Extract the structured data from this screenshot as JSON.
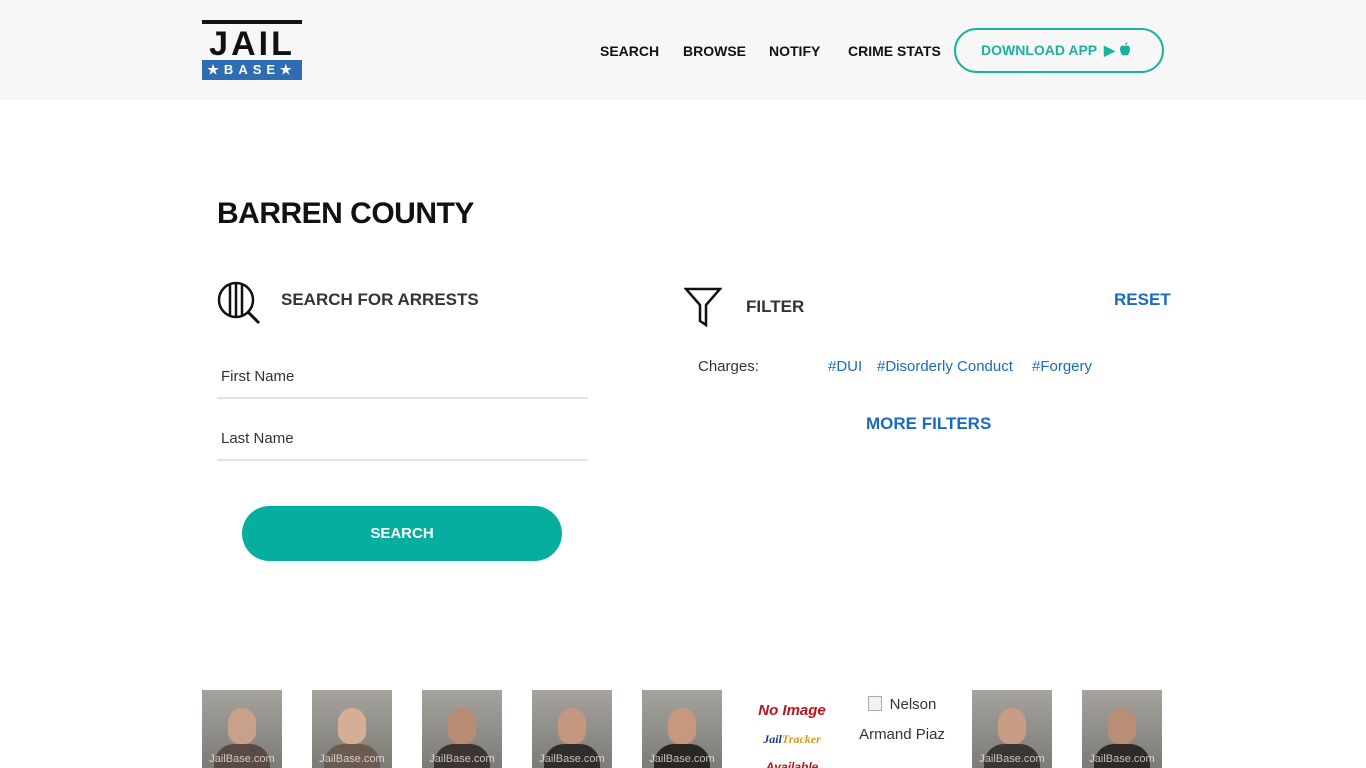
{
  "header": {
    "logo": {
      "top": "JAIL",
      "bottom": "★BASE★"
    },
    "nav": [
      "SEARCH",
      "BROWSE",
      "NOTIFY",
      "CRIME STATS"
    ],
    "download_label": "DOWNLOAD APP",
    "download_icons": "▶ "
  },
  "page": {
    "title": "BARREN COUNTY"
  },
  "search": {
    "heading": "SEARCH FOR ARRESTS",
    "first_name_placeholder": "First Name",
    "last_name_placeholder": "Last Name",
    "button_label": "SEARCH"
  },
  "filter": {
    "heading": "FILTER",
    "reset_label": "RESET",
    "charges_label": "Charges:",
    "charges": [
      "#DUI",
      "#Disorderly Conduct",
      "#Forgery"
    ],
    "more_label": "MORE FILTERS"
  },
  "gallery": {
    "watermark": "JailBase.com",
    "no_image": {
      "line1": "No Image",
      "brand_a": "Jail",
      "brand_b": "Tracker",
      "line3": "Available"
    },
    "alt_text": "Nelson Armand Piaz"
  },
  "colors": {
    "accent": "#06ae9f",
    "link": "#1a6bbf",
    "logo_blue": "#2e6db4"
  }
}
